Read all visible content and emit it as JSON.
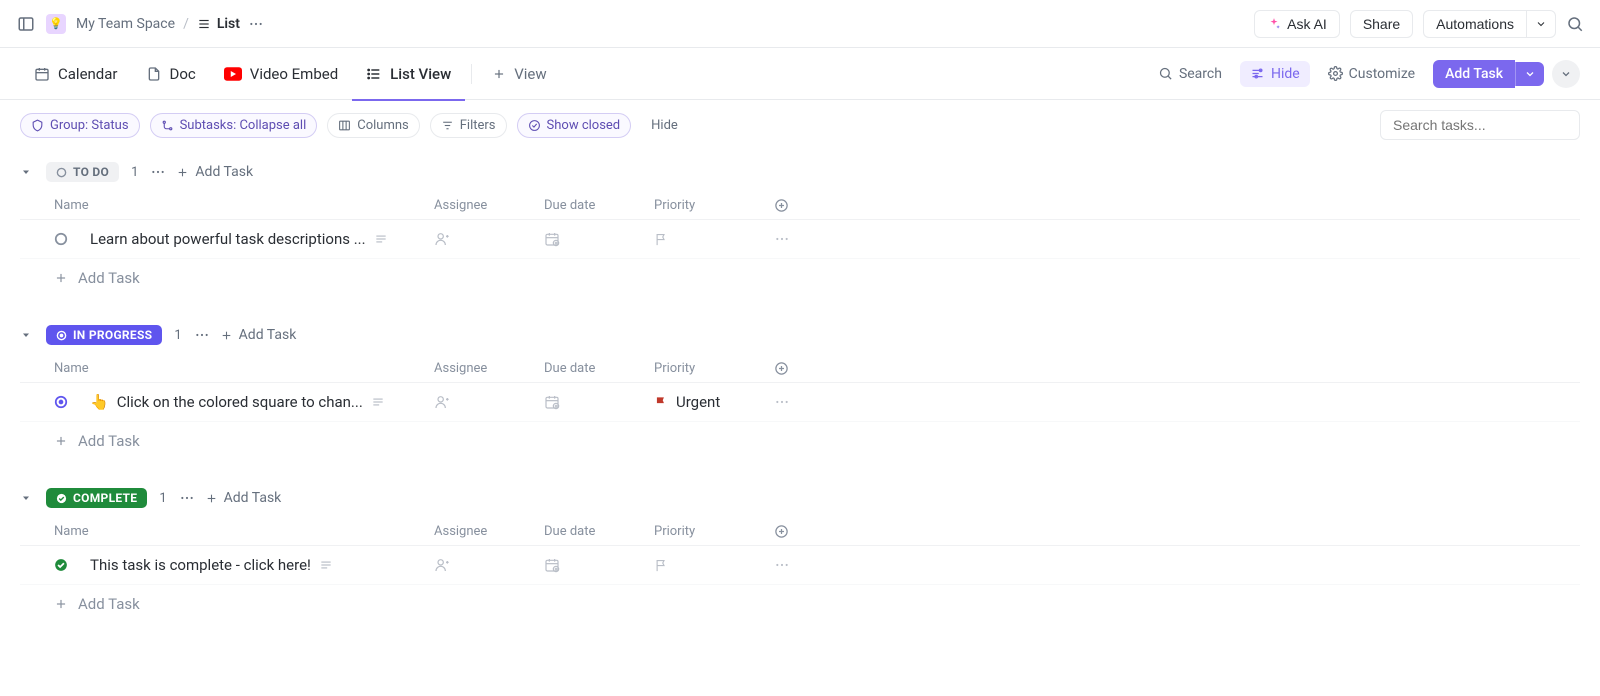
{
  "breadcrumb": {
    "space_name": "My Team Space",
    "list_label": "List"
  },
  "top_actions": {
    "ask_ai": "Ask AI",
    "share": "Share",
    "automations": "Automations"
  },
  "views": {
    "calendar": "Calendar",
    "doc": "Doc",
    "video_embed": "Video Embed",
    "list_view": "List View",
    "add_view": "View"
  },
  "view_actions": {
    "search": "Search",
    "hide": "Hide",
    "customize": "Customize",
    "add_task": "Add Task"
  },
  "filters": {
    "group": "Group: Status",
    "subtasks": "Subtasks: Collapse all",
    "columns": "Columns",
    "filters": "Filters",
    "show_closed": "Show closed",
    "hide": "Hide",
    "search_placeholder": "Search tasks..."
  },
  "columns": {
    "name": "Name",
    "assignee": "Assignee",
    "due_date": "Due date",
    "priority": "Priority"
  },
  "common": {
    "add_task": "Add Task"
  },
  "groups": {
    "todo": {
      "label": "TO DO",
      "count": "1",
      "task_name": "Learn about powerful task descriptions ..."
    },
    "in_progress": {
      "label": "IN PROGRESS",
      "count": "1",
      "task_emoji": "👆",
      "task_name": "Click on the colored square to chan...",
      "priority_label": "Urgent"
    },
    "complete": {
      "label": "COMPLETE",
      "count": "1",
      "task_name": "This task is complete - click here!"
    }
  }
}
